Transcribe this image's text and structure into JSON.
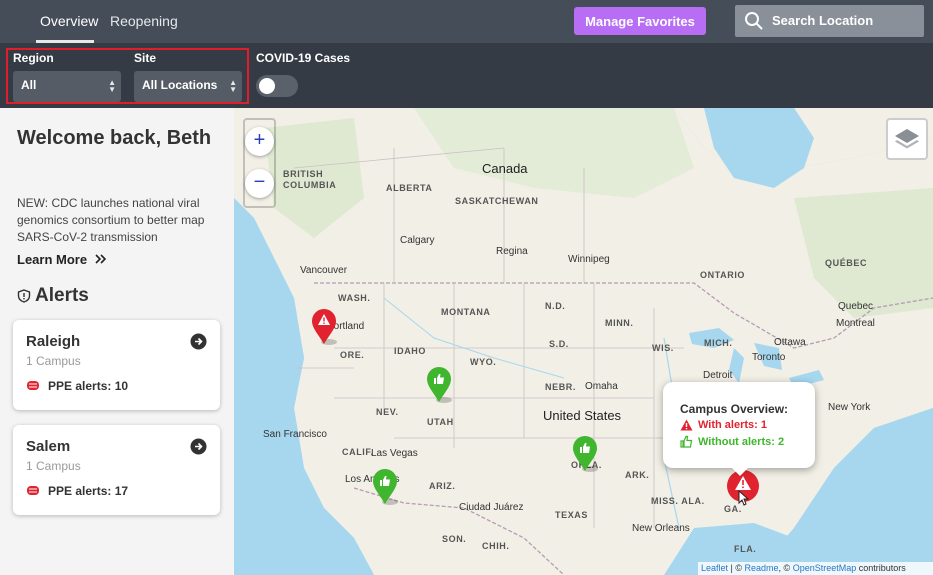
{
  "nav": {
    "tab_overview": "Overview",
    "tab_reopening": "Reopening"
  },
  "header": {
    "manage_favorites": "Manage Favorites",
    "search_placeholder": "Search Location"
  },
  "filters": {
    "region_label": "Region",
    "region_value": "All",
    "site_label": "Site",
    "site_value": "All Locations",
    "covid_label": "COVID-19 Cases",
    "covid_enabled": false
  },
  "sidebar": {
    "welcome": "Welcome back, Beth",
    "news": "NEW: CDC launches national viral genomics consortium to better map SARS-CoV-2 transmission",
    "learn_more": "Learn More",
    "learn_more_icon": "double-chevron-right-icon",
    "alerts_title": "Alerts",
    "cards": [
      {
        "name": "Raleigh",
        "sub": "1 Campus",
        "alert": "PPE alerts: 10"
      },
      {
        "name": "Salem",
        "sub": "1 Campus",
        "alert": "PPE alerts: 17"
      }
    ]
  },
  "map": {
    "labels": {
      "canada": "Canada",
      "united_states": "United States",
      "british_columbia": "BRITISH\nCOLUMBIA",
      "alberta": "ALBERTA",
      "saskatchewan": "SASKATCHEWAN",
      "ontario": "ONTARIO",
      "quebec_prov": "QUÉBEC",
      "wash": "WASH.",
      "montana": "MONTANA",
      "nd": "N.D.",
      "minn": "MINN.",
      "idaho": "IDAHO",
      "ore": "ORE.",
      "wyo": "WYO.",
      "sd": "S.D.",
      "wis": "WIS.",
      "mich": "MICH.",
      "nebr": "NEBR.",
      "nev": "NEV.",
      "utah": "UTAH",
      "calif": "CALIF.",
      "ariz": "ARIZ.",
      "okla": "OKLA.",
      "ark": "ARK.",
      "miss_ala": "MISS. ALA.",
      "texas": "TEXAS",
      "son": "SON.",
      "chih": "CHIH.",
      "ga": "GA.",
      "fla": "FLA.",
      "calgary": "Calgary",
      "regina": "Regina",
      "winnipeg": "Winnipeg",
      "vancouver": "Vancouver",
      "portland": "Portland",
      "ottawa": "Ottawa",
      "quebec_city": "Quebec",
      "montreal": "Montreal",
      "toronto": "Toronto",
      "detroit": "Detroit",
      "omaha": "Omaha",
      "new_york": "New York",
      "san_francisco": "San Francisco",
      "las_vegas": "Las Vegas",
      "los_angeles": "Los Angeles",
      "ciudad_juarez": "Ciudad Juárez",
      "new_orleans": "New Orleans"
    },
    "zoom_in": "+",
    "zoom_out": "−",
    "popup": {
      "title": "Campus Overview:",
      "with_alerts": "With alerts: 1",
      "without_alerts": "Without alerts: 2"
    },
    "attribution": {
      "leaflet": "Leaflet",
      "sep1": " | © ",
      "readme": "Readme",
      "sep2": ", © ",
      "osm": "OpenStreetMap",
      "contrib": " contributors"
    }
  },
  "colors": {
    "alert_red": "#e0232f",
    "ok_green": "#3fb62d",
    "accent_purple": "#b76ef5"
  }
}
